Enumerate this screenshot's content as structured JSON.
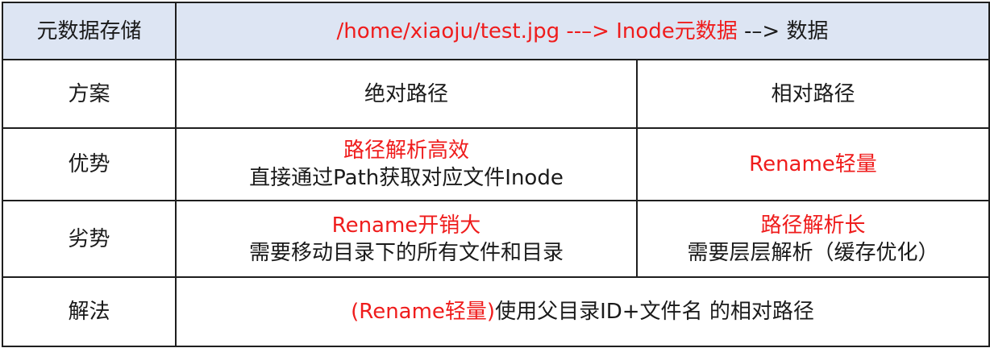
{
  "header": {
    "label": "元数据存储",
    "path_red": "/home/xiaoju/test.jpg --–> Inode元数据",
    "path_rest": " -–> 数据"
  },
  "scheme": {
    "label": "方案",
    "absolute": "绝对路径",
    "relative": "相对路径"
  },
  "advantage": {
    "label": "优势",
    "absolute_title": "路径解析高效",
    "absolute_desc": "直接通过Path获取对应文件Inode",
    "relative_title": "Rename轻量"
  },
  "disadvantage": {
    "label": "劣势",
    "absolute_title": "Rename开销大",
    "absolute_desc": "需要移动目录下的所有文件和目录",
    "relative_title": "路径解析长",
    "relative_desc": "需要层层解析（缓存优化）"
  },
  "solution": {
    "label": "解法",
    "red": "(Rename轻量)",
    "rest": "使用父目录ID+文件名 的相对路径"
  },
  "colors": {
    "header_bg": "#dde5f3",
    "accent_red": "#ef1c1c",
    "border": "#1e1e1e"
  }
}
